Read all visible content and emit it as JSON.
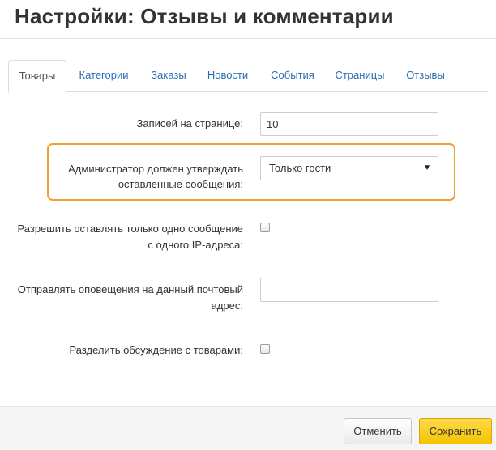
{
  "modal": {
    "title": "Настройки: Отзывы и комментарии"
  },
  "tabs": [
    {
      "label": "Товары",
      "active": true
    },
    {
      "label": "Категории",
      "active": false
    },
    {
      "label": "Заказы",
      "active": false
    },
    {
      "label": "Новости",
      "active": false
    },
    {
      "label": "События",
      "active": false
    },
    {
      "label": "Страницы",
      "active": false
    },
    {
      "label": "Отзывы",
      "active": false
    }
  ],
  "form": {
    "per_page": {
      "label": "Записей на странице:",
      "value": "10"
    },
    "admin_approve": {
      "label_line1": "Администратор должен утверждать",
      "label_line2": "оставленные сообщения:",
      "selected": "Только гости"
    },
    "one_per_ip": {
      "label_line1": "Разрешить оставлять только одно сообщение",
      "label_line2": "с одного IP-адреса:",
      "checked": false
    },
    "notify_email": {
      "label_line1": "Отправлять оповещения на данный почтовый",
      "label_line2": "адрес:",
      "value": ""
    },
    "split_discussion": {
      "label": "Разделить обсуждение с товарами:",
      "checked": false
    }
  },
  "footer": {
    "cancel_label": "Отменить",
    "save_label": "Сохранить"
  },
  "colors": {
    "link": "#2a6fb3",
    "highlight": "#f0a030",
    "save_button": "#f5c400"
  },
  "icons": {
    "select_caret": "caret-down-icon"
  }
}
